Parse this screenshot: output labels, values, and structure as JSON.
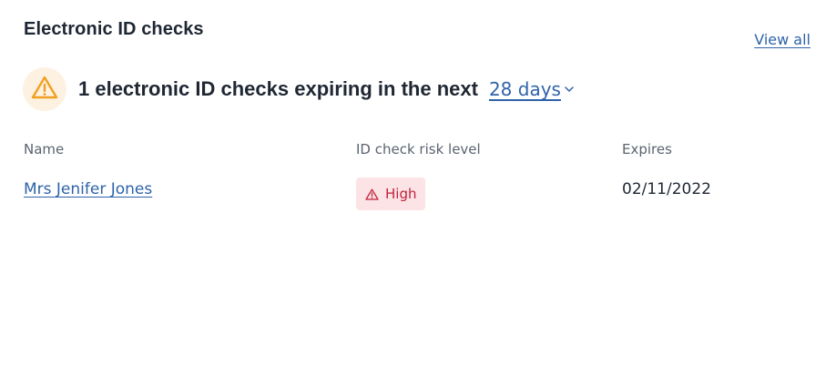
{
  "card": {
    "title": "Electronic ID checks",
    "view_all_label": "View all"
  },
  "summary": {
    "icon": "warning-triangle-icon",
    "text": "1 electronic ID checks expiring in the next",
    "period_selected": "28 days"
  },
  "table": {
    "columns": [
      "Name",
      "ID check risk level",
      "Expires"
    ],
    "rows": [
      {
        "name": "Mrs Jenifer Jones",
        "risk_level": "High",
        "expires": "02/11/2022"
      }
    ]
  },
  "colors": {
    "link": "#2e63a9",
    "warning_icon": "#f0a020",
    "warning_bg": "#fdf1e1",
    "risk_high_text": "#c0223a",
    "risk_high_bg": "#fbe3e6"
  }
}
